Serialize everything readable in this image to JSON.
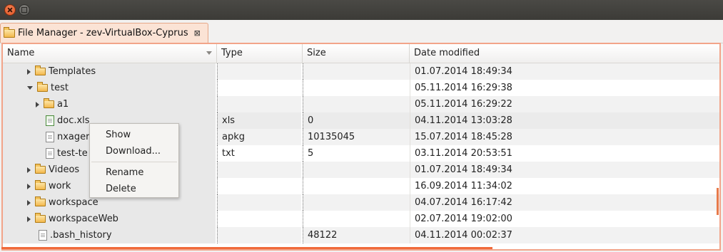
{
  "window": {
    "close_label": "",
    "maximize_label": ""
  },
  "tab": {
    "title": "File Manager - zev-VirtualBox-Cyprus",
    "close_glyph": "⊠"
  },
  "toolbar": {
    "sync_icon": "sync-icon",
    "menu_icon": "chevron-down-icon"
  },
  "columns": {
    "name": "Name",
    "type": "Type",
    "size": "Size",
    "date": "Date modified"
  },
  "rows": [
    {
      "name": "Templates",
      "type": "",
      "size": "",
      "date": "01.07.2014 18:49:34"
    },
    {
      "name": "test",
      "type": "",
      "size": "",
      "date": "05.11.2014 16:29:38"
    },
    {
      "name": "a1",
      "type": "",
      "size": "",
      "date": "05.11.2014 16:29:22"
    },
    {
      "name": "doc.xls",
      "type": "xls",
      "size": "0",
      "date": "04.11.2014 13:03:28"
    },
    {
      "name": "nxager",
      "type": "apkg",
      "size": "10135045",
      "date": "15.07.2014 18:45:28"
    },
    {
      "name": "test-te",
      "type": "txt",
      "size": "5",
      "date": "03.11.2014 20:53:51"
    },
    {
      "name": "Videos",
      "type": "",
      "size": "",
      "date": "01.07.2014 18:49:34"
    },
    {
      "name": "work",
      "type": "",
      "size": "",
      "date": "16.09.2014 11:34:02"
    },
    {
      "name": "workspace",
      "type": "",
      "size": "",
      "date": "04.07.2014 16:17:42"
    },
    {
      "name": "workspaceWeb",
      "type": "",
      "size": "",
      "date": "02.07.2014 19:02:00"
    },
    {
      "name": ".bash_history",
      "type": "",
      "size": "48122",
      "date": "04.11.2014 00:02:37"
    }
  ],
  "context_menu": {
    "show": "Show",
    "download": "Download...",
    "rename": "Rename",
    "delete": "Delete"
  }
}
